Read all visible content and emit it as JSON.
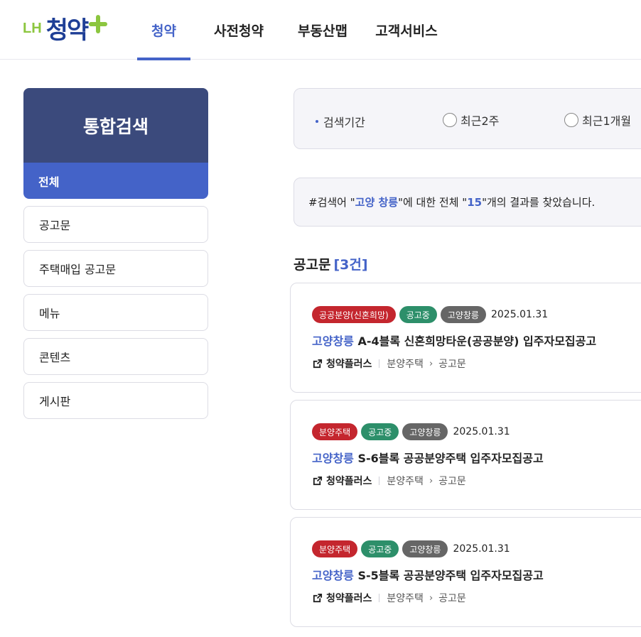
{
  "header": {
    "logo_lh": "LH",
    "logo_main": "청약",
    "nav": [
      {
        "label": "청약",
        "active": true
      },
      {
        "label": "사전청약",
        "active": false
      },
      {
        "label": "부동산맵",
        "active": false
      },
      {
        "label": "고객서비스",
        "active": false
      }
    ]
  },
  "sidebar": {
    "title": "통합검색",
    "active_item": "전체",
    "items": [
      "공고문",
      "주택매입 공고문",
      "메뉴",
      "콘텐츠",
      "게시판"
    ]
  },
  "filter": {
    "label": "검색기간",
    "options": [
      "최근2주",
      "최근1개월"
    ]
  },
  "result": {
    "prefix": "#검색어 \"",
    "keyword": "고양 창릉",
    "middle": "\"에 대한 전체 \"",
    "count": "15",
    "suffix": "\"개의 결과를 찾았습니다."
  },
  "section": {
    "title": "공고문",
    "count": "[3건]"
  },
  "cards": [
    {
      "tags": [
        {
          "label": "공공분양(신혼희망)",
          "color": "#c4262e"
        },
        {
          "label": "공고중",
          "color": "#2d8f6a"
        },
        {
          "label": "고양창릉",
          "color": "#666666"
        }
      ],
      "date": "2025.01.31",
      "location": "고양창릉",
      "title": "A-4블록 신혼희망타운(공공분양) 입주자모집공고",
      "source": "청약플러스",
      "crumb1": "분양주택",
      "crumb2": "공고문"
    },
    {
      "tags": [
        {
          "label": "분양주택",
          "color": "#c4262e"
        },
        {
          "label": "공고중",
          "color": "#2d8f6a"
        },
        {
          "label": "고양창릉",
          "color": "#666666"
        }
      ],
      "date": "2025.01.31",
      "location": "고양창릉",
      "title": "S-6블록 공공분양주택 입주자모집공고",
      "source": "청약플러스",
      "crumb1": "분양주택",
      "crumb2": "공고문"
    },
    {
      "tags": [
        {
          "label": "분양주택",
          "color": "#c4262e"
        },
        {
          "label": "공고중",
          "color": "#2d8f6a"
        },
        {
          "label": "고양창릉",
          "color": "#666666"
        }
      ],
      "date": "2025.01.31",
      "location": "고양창릉",
      "title": "S-5블록 공공분양주택 입주자모집공고",
      "source": "청약플러스",
      "crumb1": "분양주택",
      "crumb2": "공고문"
    }
  ],
  "colors": {
    "accent": "#4463c8",
    "sidebar_head": "#3b4a7c",
    "logo_green": "#8cc63f",
    "logo_blue": "#1f3f96"
  }
}
